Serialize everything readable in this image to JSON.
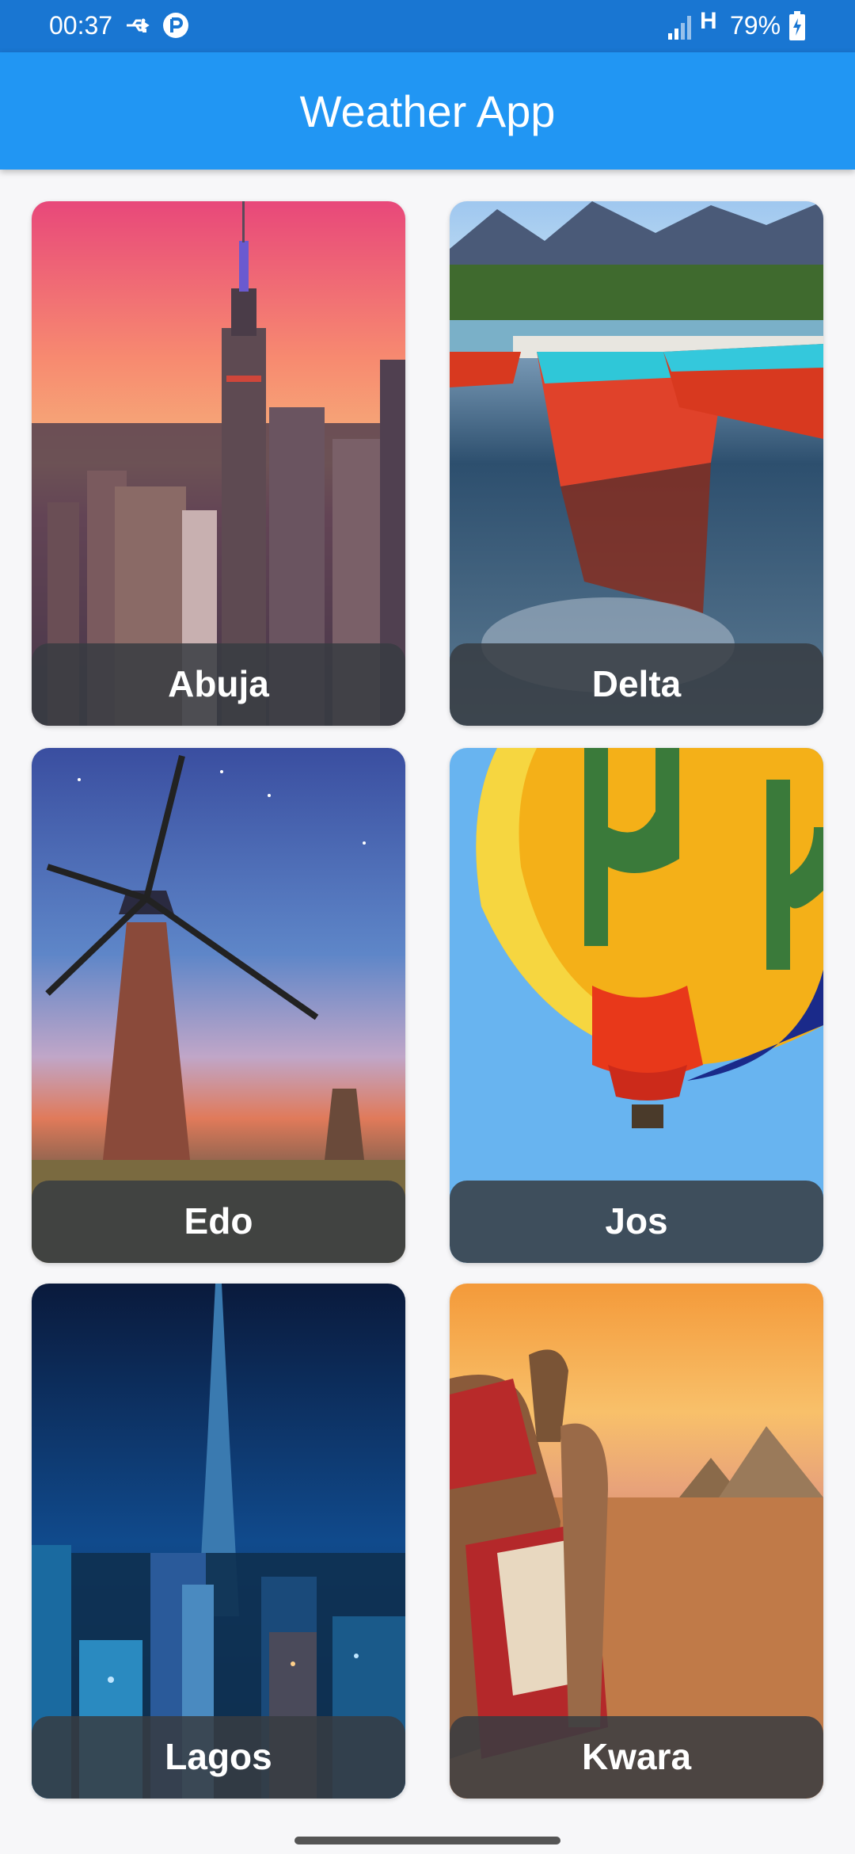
{
  "status_bar": {
    "time": "00:37",
    "icons": [
      "usb-icon",
      "app-notification-icon",
      "signal-icon",
      "network-h-icon",
      "battery-charging-icon"
    ],
    "network": "H",
    "battery": "79%"
  },
  "app_bar": {
    "title": "Weather App"
  },
  "cities": [
    {
      "name": "Abuja",
      "image": "city-skyline-sunset"
    },
    {
      "name": "Delta",
      "image": "boats-on-lake"
    },
    {
      "name": "Edo",
      "image": "windmill-night"
    },
    {
      "name": "Jos",
      "image": "hot-air-balloon"
    },
    {
      "name": "Lagos",
      "image": "night-tower-skyline"
    },
    {
      "name": "Kwara",
      "image": "camels-pyramids"
    }
  ],
  "colors": {
    "status_bar": "#1976d2",
    "app_bar": "#2196f3",
    "label_overlay": "#373c42",
    "background": "#f7f7f9"
  }
}
